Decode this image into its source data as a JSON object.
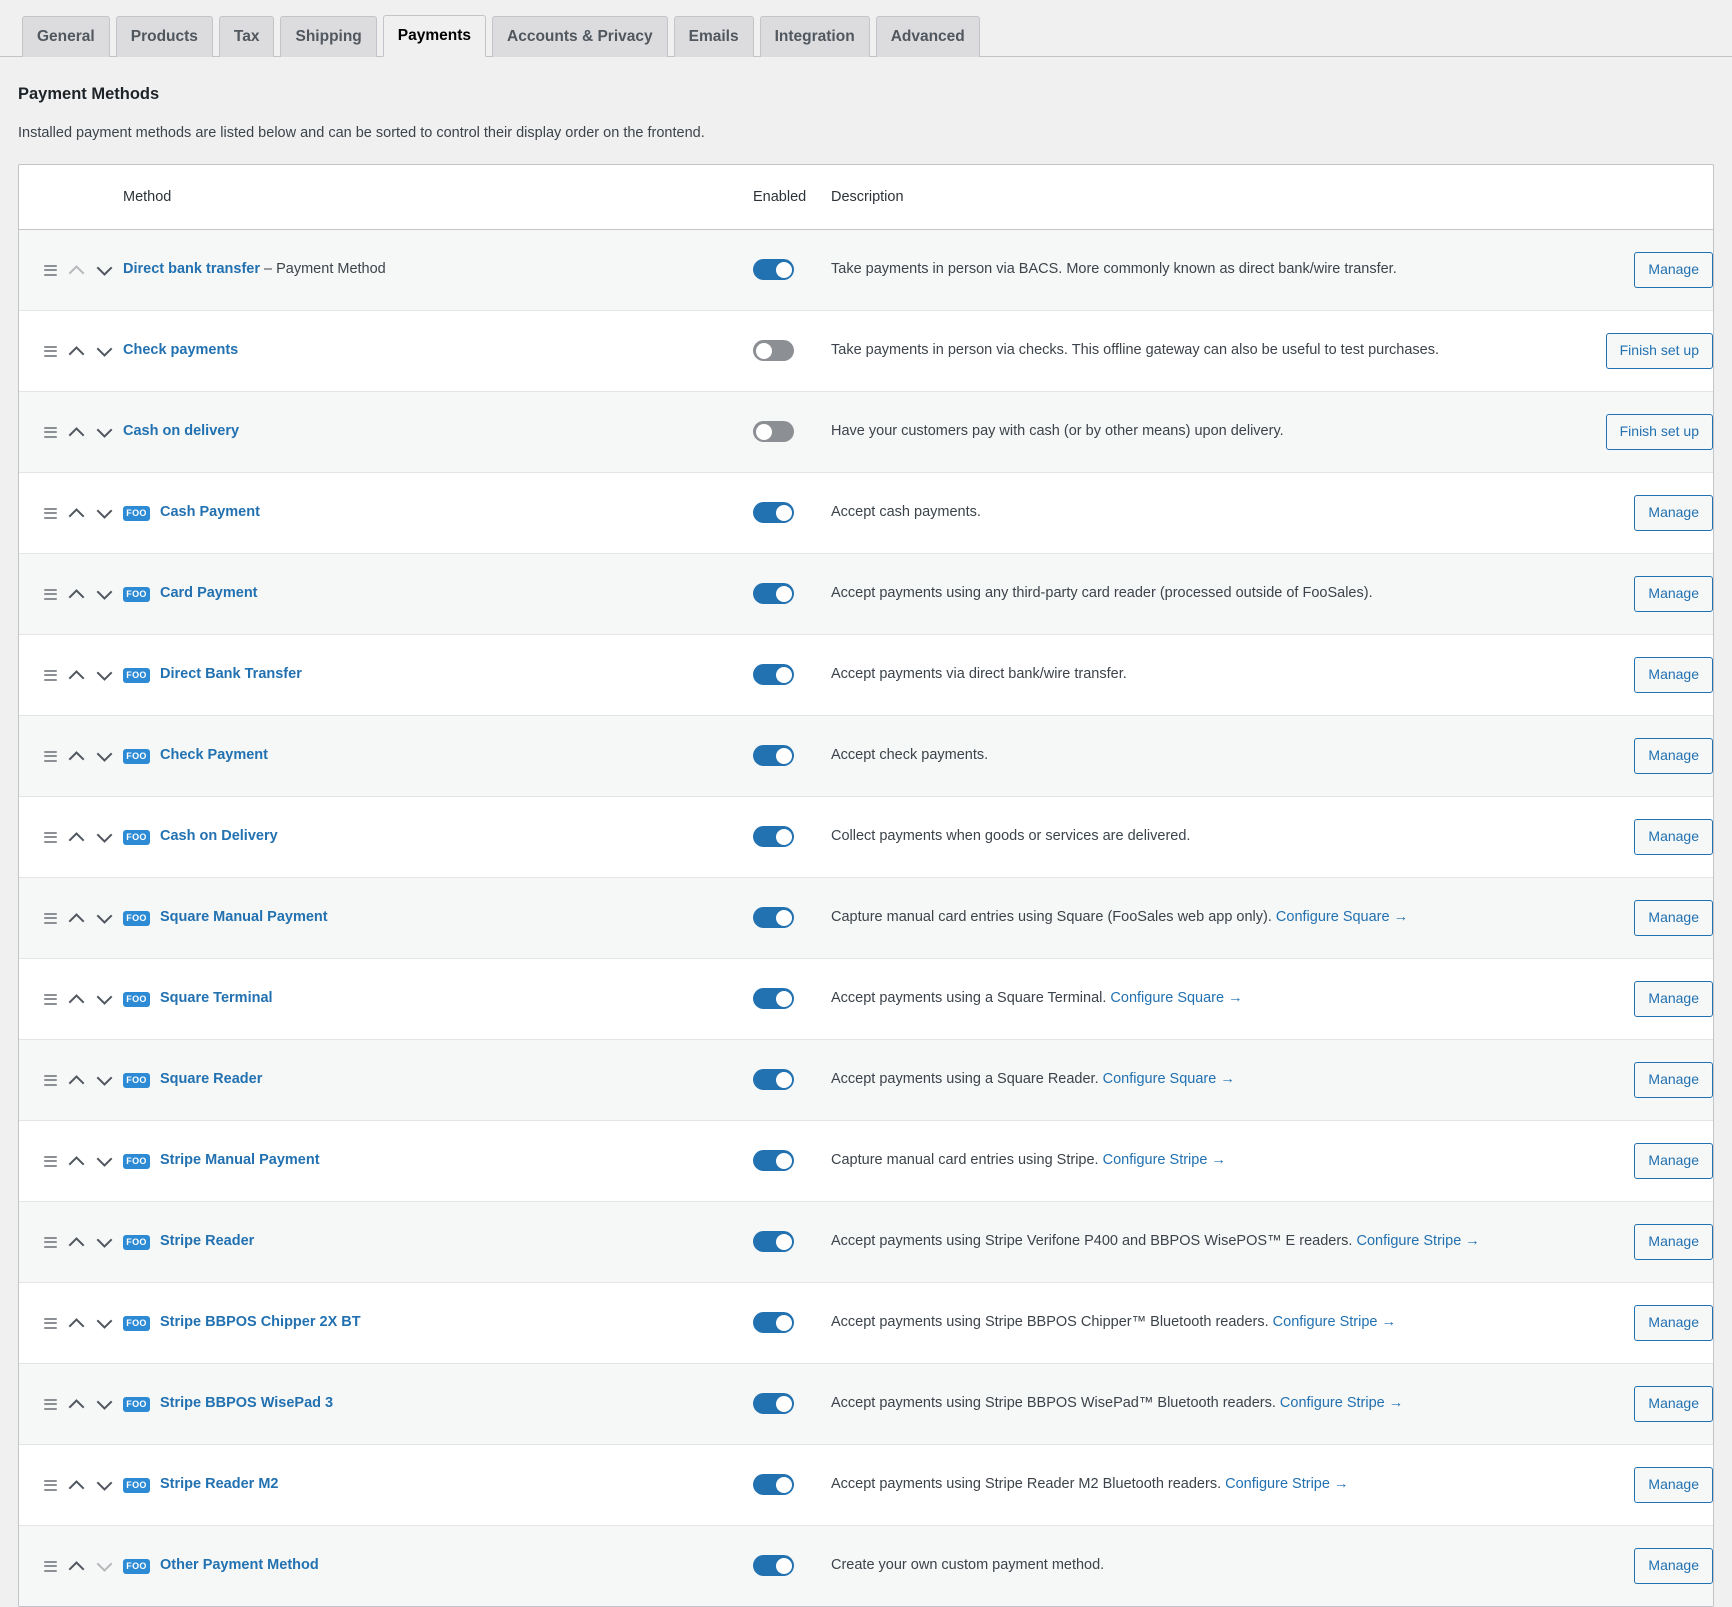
{
  "tabs": [
    {
      "label": "General",
      "active": false
    },
    {
      "label": "Products",
      "active": false
    },
    {
      "label": "Tax",
      "active": false
    },
    {
      "label": "Shipping",
      "active": false
    },
    {
      "label": "Payments",
      "active": true
    },
    {
      "label": "Accounts & Privacy",
      "active": false
    },
    {
      "label": "Emails",
      "active": false
    },
    {
      "label": "Integration",
      "active": false
    },
    {
      "label": "Advanced",
      "active": false
    }
  ],
  "page": {
    "title": "Payment Methods",
    "description": "Installed payment methods are listed below and can be sorted to control their display order on the frontend."
  },
  "table": {
    "headers": {
      "sort": "",
      "method": "Method",
      "enabled": "Enabled",
      "description": "Description",
      "action": ""
    },
    "rows": [
      {
        "name": "Direct bank transfer",
        "suffix": " – Payment Method",
        "foo": false,
        "enabled": true,
        "desc": "Take payments in person via BACS. More commonly known as direct bank/wire transfer.",
        "link": "",
        "action": "Manage",
        "up_disabled": true,
        "down_disabled": false
      },
      {
        "name": "Check payments",
        "suffix": "",
        "foo": false,
        "enabled": false,
        "desc": "Take payments in person via checks. This offline gateway can also be useful to test purchases.",
        "link": "",
        "action": "Finish set up",
        "up_disabled": false,
        "down_disabled": false
      },
      {
        "name": "Cash on delivery",
        "suffix": "",
        "foo": false,
        "enabled": false,
        "desc": "Have your customers pay with cash (or by other means) upon delivery.",
        "link": "",
        "action": "Finish set up",
        "up_disabled": false,
        "down_disabled": false
      },
      {
        "name": "Cash Payment",
        "suffix": "",
        "foo": true,
        "enabled": true,
        "desc": "Accept cash payments.",
        "link": "",
        "action": "Manage",
        "up_disabled": false,
        "down_disabled": false
      },
      {
        "name": "Card Payment",
        "suffix": "",
        "foo": true,
        "enabled": true,
        "desc": "Accept payments using any third-party card reader (processed outside of FooSales).",
        "link": "",
        "action": "Manage",
        "up_disabled": false,
        "down_disabled": false
      },
      {
        "name": "Direct Bank Transfer",
        "suffix": "",
        "foo": true,
        "enabled": true,
        "desc": "Accept payments via direct bank/wire transfer.",
        "link": "",
        "action": "Manage",
        "up_disabled": false,
        "down_disabled": false
      },
      {
        "name": "Check Payment",
        "suffix": "",
        "foo": true,
        "enabled": true,
        "desc": "Accept check payments.",
        "link": "",
        "action": "Manage",
        "up_disabled": false,
        "down_disabled": false
      },
      {
        "name": "Cash on Delivery",
        "suffix": "",
        "foo": true,
        "enabled": true,
        "desc": "Collect payments when goods or services are delivered.",
        "link": "",
        "action": "Manage",
        "up_disabled": false,
        "down_disabled": false
      },
      {
        "name": "Square Manual Payment",
        "suffix": "",
        "foo": true,
        "enabled": true,
        "desc": "Capture manual card entries using Square (FooSales web app only). ",
        "link": "Configure Square →",
        "action": "Manage",
        "up_disabled": false,
        "down_disabled": false
      },
      {
        "name": "Square Terminal",
        "suffix": "",
        "foo": true,
        "enabled": true,
        "desc": "Accept payments using a Square Terminal. ",
        "link": "Configure Square →",
        "action": "Manage",
        "up_disabled": false,
        "down_disabled": false
      },
      {
        "name": "Square Reader",
        "suffix": "",
        "foo": true,
        "enabled": true,
        "desc": "Accept payments using a Square Reader. ",
        "link": "Configure Square →",
        "action": "Manage",
        "up_disabled": false,
        "down_disabled": false
      },
      {
        "name": "Stripe Manual Payment",
        "suffix": "",
        "foo": true,
        "enabled": true,
        "desc": "Capture manual card entries using Stripe. ",
        "link": "Configure Stripe →",
        "action": "Manage",
        "up_disabled": false,
        "down_disabled": false
      },
      {
        "name": "Stripe Reader",
        "suffix": "",
        "foo": true,
        "enabled": true,
        "desc": "Accept payments using Stripe Verifone P400 and BBPOS WisePOS™ E readers. ",
        "link": "Configure Stripe →",
        "action": "Manage",
        "up_disabled": false,
        "down_disabled": false
      },
      {
        "name": "Stripe BBPOS Chipper 2X BT",
        "suffix": "",
        "foo": true,
        "enabled": true,
        "desc": "Accept payments using Stripe BBPOS Chipper™ Bluetooth readers. ",
        "link": "Configure Stripe →",
        "action": "Manage",
        "up_disabled": false,
        "down_disabled": false
      },
      {
        "name": "Stripe BBPOS WisePad 3",
        "suffix": "",
        "foo": true,
        "enabled": true,
        "desc": "Accept payments using Stripe BBPOS WisePad™ Bluetooth readers. ",
        "link": "Configure Stripe →",
        "action": "Manage",
        "up_disabled": false,
        "down_disabled": false
      },
      {
        "name": "Stripe Reader M2",
        "suffix": "",
        "foo": true,
        "enabled": true,
        "desc": "Accept payments using Stripe Reader M2 Bluetooth readers. ",
        "link": "Configure Stripe →",
        "action": "Manage",
        "up_disabled": false,
        "down_disabled": false
      },
      {
        "name": "Other Payment Method",
        "suffix": "",
        "foo": true,
        "enabled": true,
        "desc": "Create your own custom payment method.",
        "link": "",
        "action": "Manage",
        "up_disabled": false,
        "down_disabled": true
      }
    ]
  },
  "icons": {
    "foo_label": "FOO",
    "drag_handle": "drag-handle-icon",
    "chevron_up": "chevron-up-icon",
    "chevron_down": "chevron-down-icon"
  },
  "colors": {
    "accent": "#2271b1",
    "toggle_on": "#2271b1",
    "toggle_off": "#8c8f94",
    "foo_badge": "#2d8ad4",
    "page_bg": "#f0f0f1"
  }
}
